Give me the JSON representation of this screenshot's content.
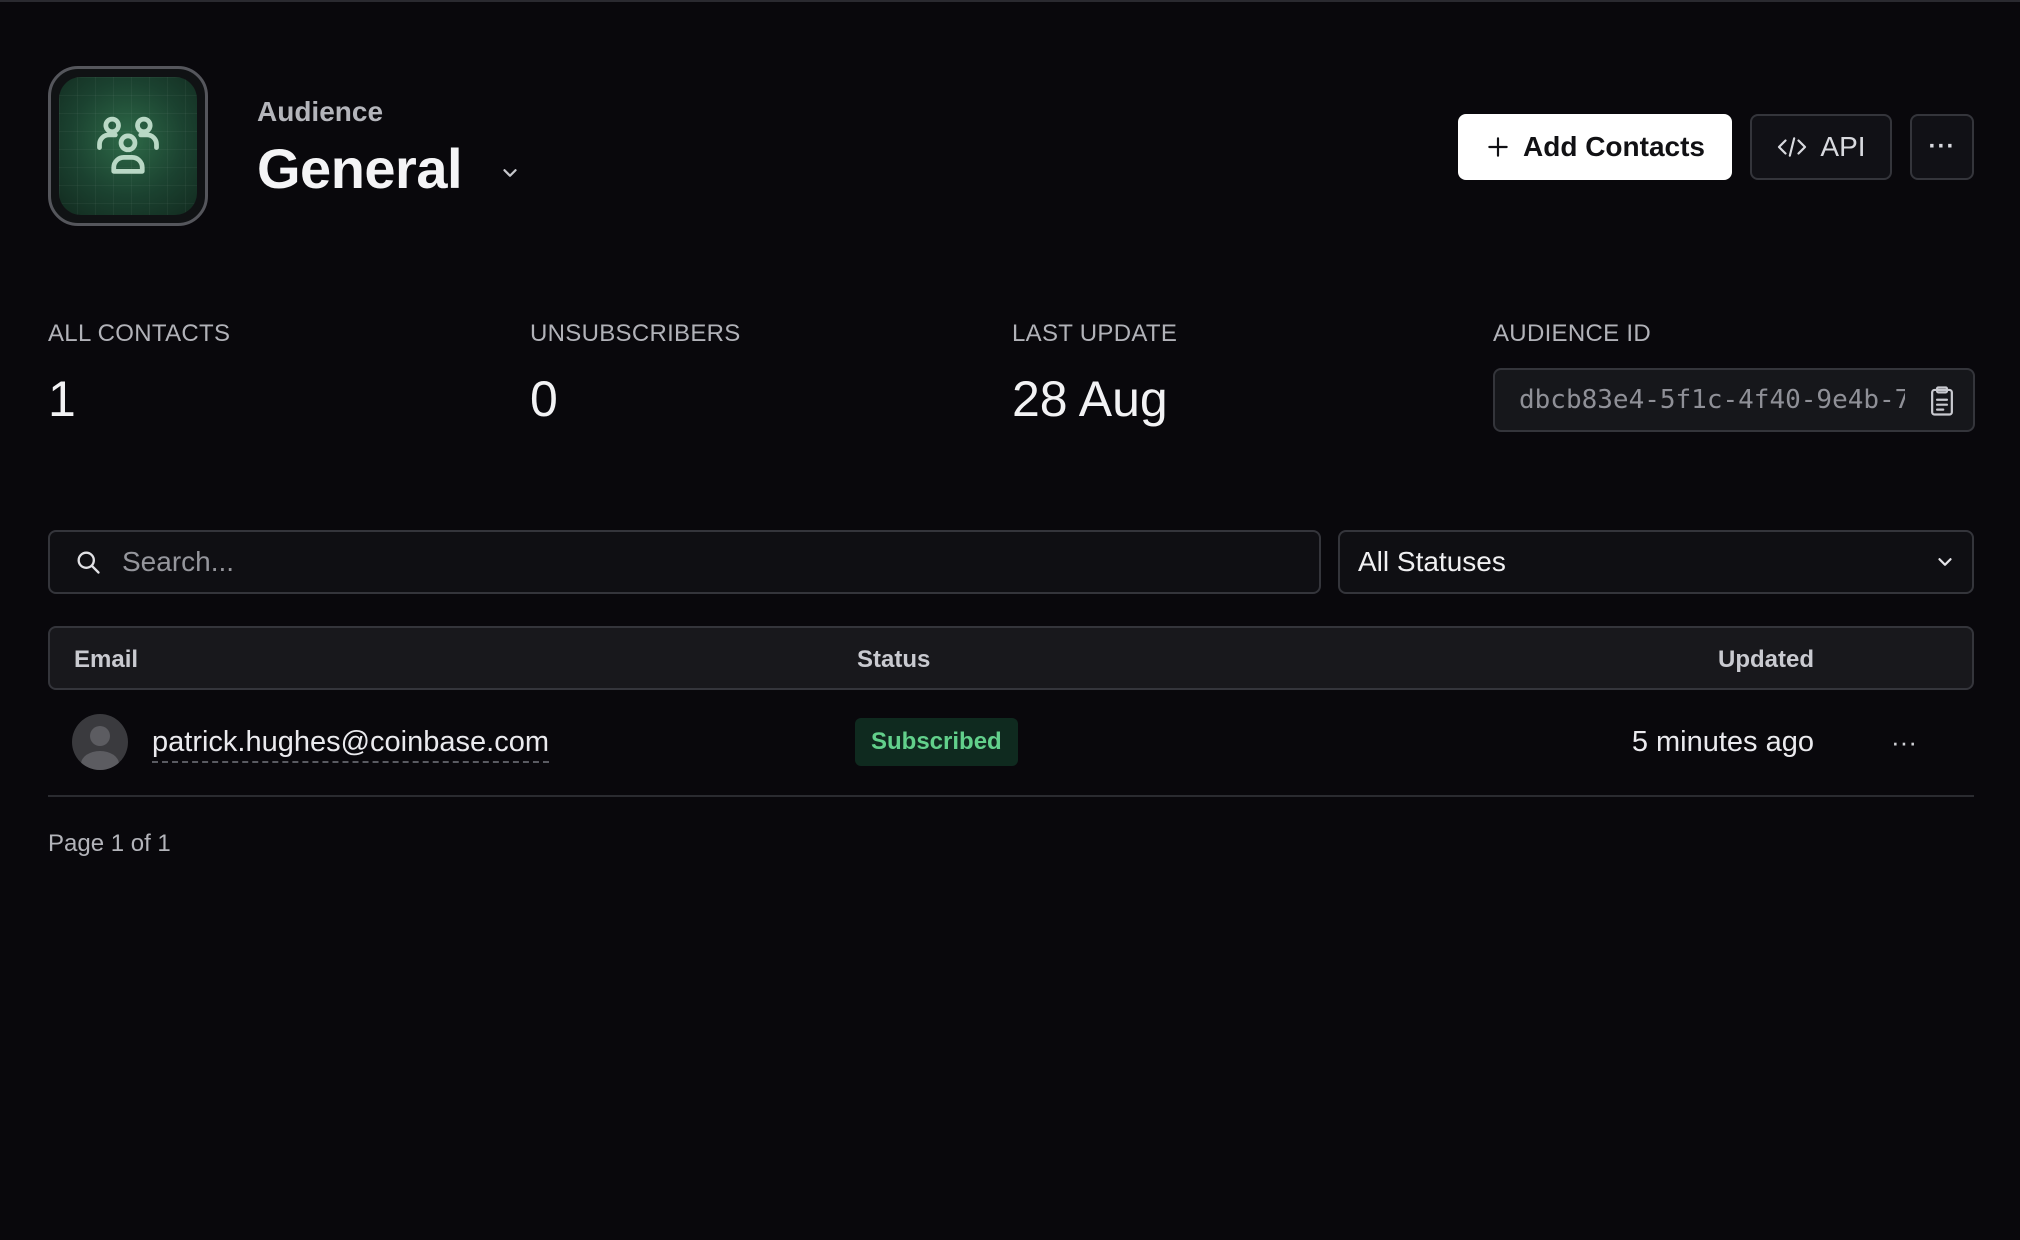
{
  "header": {
    "eyebrow": "Audience",
    "title": "General",
    "add_contacts_label": "Add Contacts",
    "api_label": "API",
    "more_label": "···"
  },
  "stats": [
    {
      "label": "ALL CONTACTS",
      "value": "1"
    },
    {
      "label": "UNSUBSCRIBERS",
      "value": "0"
    },
    {
      "label": "LAST UPDATE",
      "value": "28 Aug"
    },
    {
      "label": "AUDIENCE ID",
      "value": "dbcb83e4-5f1c-4f40-9e4b-7"
    }
  ],
  "filters": {
    "search_placeholder": "Search...",
    "status_selected": "All Statuses"
  },
  "table": {
    "columns": [
      "Email",
      "Status",
      "Updated"
    ],
    "rows": [
      {
        "email": "patrick.hughes@coinbase.com",
        "status": "Subscribed",
        "updated": "5 minutes ago",
        "more": "···"
      }
    ]
  },
  "pagination": "Page 1 of 1",
  "colors": {
    "background": "#09080c",
    "accent_green": "#62d08b",
    "badge_bg": "#0f2a1f",
    "primary_button": "#ffffff"
  },
  "icons": [
    "users-group-icon",
    "chevron-down-icon",
    "plus-icon",
    "code-icon",
    "more-horizontal-icon",
    "clipboard-icon",
    "search-icon",
    "avatar-placeholder-icon"
  ]
}
